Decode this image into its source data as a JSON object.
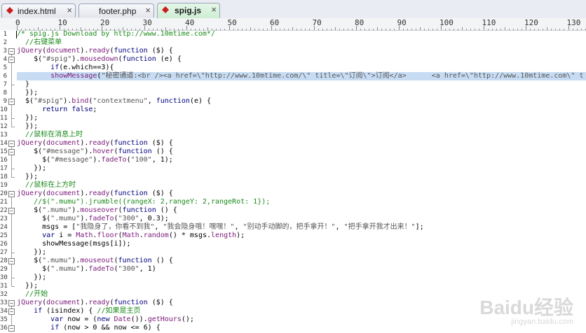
{
  "tabs": [
    {
      "label": "index.html",
      "icon": "red-diamond-icon",
      "active": false
    },
    {
      "label": "footer.php",
      "icon": "",
      "active": false
    },
    {
      "label": "spig.js",
      "icon": "red-diamond-icon",
      "active": true
    }
  ],
  "tab_close_glyph": "×",
  "ruler_labels": [
    "0",
    "10",
    "20",
    "30",
    "40",
    "50",
    "60",
    "70",
    "80",
    "90",
    "100",
    "110",
    "120",
    "130"
  ],
  "line_numbers": [
    "1",
    "2",
    "3",
    "4",
    "5",
    "6",
    "7",
    "8",
    "9",
    "10",
    "11",
    "12",
    "13",
    "14",
    "15",
    "16",
    "17",
    "18",
    "19",
    "20",
    "21",
    "22",
    "23",
    "24",
    "25",
    "26",
    "27",
    "28",
    "29",
    "30",
    "31",
    "32",
    "33",
    "34",
    "35",
    "36"
  ],
  "code_lines": [
    [
      [
        "cmt",
        "/* spig.js Download by http://www.10mtime.com*/"
      ]
    ],
    [
      [
        "cmt",
        "  //右键菜单"
      ]
    ],
    [
      [
        "obj",
        "jQuery"
      ],
      [
        "",
        "("
      ],
      [
        "obj",
        "document"
      ],
      [
        "",
        ")."
      ],
      [
        "obj",
        "ready"
      ],
      [
        "",
        "("
      ],
      [
        "kw",
        "function"
      ],
      [
        "",
        " ($) {"
      ]
    ],
    [
      [
        "",
        "    $("
      ],
      [
        "str",
        "\"#spig\""
      ],
      [
        "",
        ")."
      ],
      [
        "obj",
        "mousedown"
      ],
      [
        "",
        "("
      ],
      [
        "kw",
        "function"
      ],
      [
        "",
        " (e) {"
      ]
    ],
    [
      [
        "",
        "        "
      ],
      [
        "kw",
        "if"
      ],
      [
        "",
        "(e.which==3){"
      ]
    ],
    [
      [
        "",
        "        "
      ],
      [
        "obj",
        "showMessage"
      ],
      [
        "",
        "("
      ],
      [
        "str",
        "\"秘密通道:<br /><a href=\\\"http://www.10mtime.com/\\\" title=\\\"订阅\\\">订阅</a>      <a href=\\\"http://www.10mtime.com\\\" t"
      ]
    ],
    [
      [
        "",
        "  }"
      ]
    ],
    [
      [
        "",
        "  });"
      ]
    ],
    [
      [
        "",
        "  $("
      ],
      [
        "str",
        "\"#spig\""
      ],
      [
        "",
        ")."
      ],
      [
        "obj",
        "bind"
      ],
      [
        "",
        "("
      ],
      [
        "str",
        "\"contextmenu\""
      ],
      [
        "",
        ", "
      ],
      [
        "kw",
        "function"
      ],
      [
        "",
        "(e) {"
      ]
    ],
    [
      [
        "",
        "      "
      ],
      [
        "kw",
        "return false"
      ],
      [
        "",
        ";"
      ]
    ],
    [
      [
        "",
        "  });"
      ]
    ],
    [
      [
        "",
        "  });"
      ]
    ],
    [
      [
        "cmt",
        "  //鼠标在消息上时"
      ]
    ],
    [
      [
        "obj",
        "jQuery"
      ],
      [
        "",
        "("
      ],
      [
        "obj",
        "document"
      ],
      [
        "",
        ")."
      ],
      [
        "obj",
        "ready"
      ],
      [
        "",
        "("
      ],
      [
        "kw",
        "function"
      ],
      [
        "",
        " ($) {"
      ]
    ],
    [
      [
        "",
        "    $("
      ],
      [
        "str",
        "\"#message\""
      ],
      [
        "",
        ")."
      ],
      [
        "obj",
        "hover"
      ],
      [
        "",
        "("
      ],
      [
        "kw",
        "function"
      ],
      [
        "",
        " () {"
      ]
    ],
    [
      [
        "",
        "      $("
      ],
      [
        "str",
        "\"#message\""
      ],
      [
        "",
        ")."
      ],
      [
        "obj",
        "fadeTo"
      ],
      [
        "",
        "("
      ],
      [
        "str",
        "\"100\""
      ],
      [
        "",
        ", 1);"
      ]
    ],
    [
      [
        "",
        "    });"
      ]
    ],
    [
      [
        "",
        "  });"
      ]
    ],
    [
      [
        "cmt",
        "  //鼠标在上方时"
      ]
    ],
    [
      [
        "obj",
        "jQuery"
      ],
      [
        "",
        "("
      ],
      [
        "obj",
        "document"
      ],
      [
        "",
        ")."
      ],
      [
        "obj",
        "ready"
      ],
      [
        "",
        "("
      ],
      [
        "kw",
        "function"
      ],
      [
        "",
        " ($) {"
      ]
    ],
    [
      [
        "cmt",
        "    //$(\".mumu\").jrumble({rangeX: 2,rangeY: 2,rangeRot: 1});"
      ]
    ],
    [
      [
        "",
        "    $("
      ],
      [
        "str",
        "\".mumu\""
      ],
      [
        "",
        ")."
      ],
      [
        "obj",
        "mouseover"
      ],
      [
        "",
        "("
      ],
      [
        "kw",
        "function"
      ],
      [
        "",
        " () {"
      ]
    ],
    [
      [
        "",
        "      $("
      ],
      [
        "str",
        "\".mumu\""
      ],
      [
        "",
        ")."
      ],
      [
        "obj",
        "fadeTo"
      ],
      [
        "",
        "("
      ],
      [
        "str",
        "\"300\""
      ],
      [
        "",
        ", 0.3);"
      ]
    ],
    [
      [
        "",
        "      msgs = ["
      ],
      [
        "str",
        "\"我隐身了，你看不到我\""
      ],
      [
        "",
        ", "
      ],
      [
        "str",
        "\"我会隐身哦！嘿嘿！\""
      ],
      [
        "",
        ", "
      ],
      [
        "str",
        "\"别动手动脚的，把手拿开！\""
      ],
      [
        "",
        ", "
      ],
      [
        "str",
        "\"把手拿开我才出来！\""
      ],
      [
        "",
        "];"
      ]
    ],
    [
      [
        "",
        "      "
      ],
      [
        "kw",
        "var"
      ],
      [
        "",
        " i = "
      ],
      [
        "obj",
        "Math"
      ],
      [
        "",
        "."
      ],
      [
        "obj",
        "floor"
      ],
      [
        "",
        "("
      ],
      [
        "obj",
        "Math"
      ],
      [
        "",
        "."
      ],
      [
        "obj",
        "random"
      ],
      [
        "",
        "() * msgs."
      ],
      [
        "obj",
        "length"
      ],
      [
        "",
        ");"
      ]
    ],
    [
      [
        "",
        "      showMessage(msgs[i]);"
      ]
    ],
    [
      [
        "",
        "    });"
      ]
    ],
    [
      [
        "",
        "    $("
      ],
      [
        "str",
        "\".mumu\""
      ],
      [
        "",
        ")."
      ],
      [
        "obj",
        "mouseout"
      ],
      [
        "",
        "("
      ],
      [
        "kw",
        "function"
      ],
      [
        "",
        " () {"
      ]
    ],
    [
      [
        "",
        "      $("
      ],
      [
        "str",
        "\".mumu\""
      ],
      [
        "",
        ")."
      ],
      [
        "obj",
        "fadeTo"
      ],
      [
        "",
        "("
      ],
      [
        "str",
        "\"300\""
      ],
      [
        "",
        ", 1)"
      ]
    ],
    [
      [
        "",
        "    });"
      ]
    ],
    [
      [
        "",
        "  });"
      ]
    ],
    [
      [
        "cmt",
        "  //开始"
      ]
    ],
    [
      [
        "obj",
        "jQuery"
      ],
      [
        "",
        "("
      ],
      [
        "obj",
        "document"
      ],
      [
        "",
        ")."
      ],
      [
        "obj",
        "ready"
      ],
      [
        "",
        "("
      ],
      [
        "kw",
        "function"
      ],
      [
        "",
        " ($) {"
      ]
    ],
    [
      [
        "",
        "    "
      ],
      [
        "kw",
        "if"
      ],
      [
        "",
        " (isindex) { "
      ],
      [
        "cmt",
        "//如果是主页"
      ]
    ],
    [
      [
        "",
        "        "
      ],
      [
        "kw",
        "var"
      ],
      [
        "",
        " now = ("
      ],
      [
        "kw",
        "new"
      ],
      [
        "",
        " "
      ],
      [
        "obj",
        "Date"
      ],
      [
        "",
        "())."
      ],
      [
        "obj",
        "getHours"
      ],
      [
        "",
        "();"
      ]
    ],
    [
      [
        "",
        "        "
      ],
      [
        "kw",
        "if"
      ],
      [
        "",
        " (now > 0 && now <= 6) {"
      ]
    ]
  ],
  "highlighted_line": 6,
  "watermark": {
    "brand": "Baidu经验",
    "url": "jingyan.baidu.com"
  },
  "colors": {
    "active_tab": "#cdeed4",
    "highlight": "#c7dcf3",
    "comment": "#1a8a1a",
    "keyword": "#00007f",
    "tab_icon": "#c81e1e"
  }
}
